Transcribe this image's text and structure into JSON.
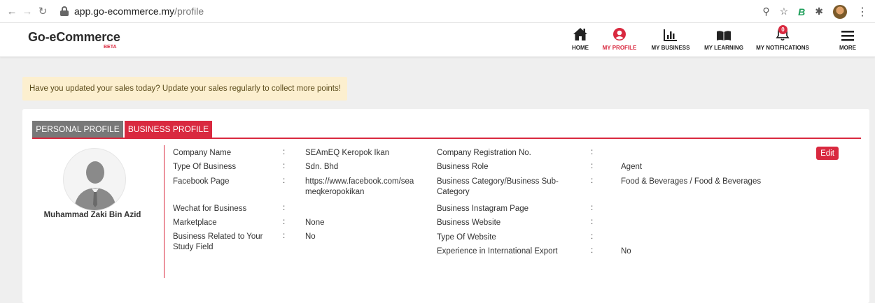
{
  "browser": {
    "url_host": "app.go-ecommerce.my",
    "url_path": "/profile"
  },
  "header": {
    "logo": "Go-eCommerce",
    "logo_badge": "BETA",
    "nav": [
      {
        "label": "HOME",
        "icon": "home-icon"
      },
      {
        "label": "MY PROFILE",
        "icon": "user-circle-icon",
        "active": true
      },
      {
        "label": "MY BUSINESS",
        "icon": "bar-chart-icon"
      },
      {
        "label": "MY LEARNING",
        "icon": "book-icon"
      },
      {
        "label": "MY NOTIFICATIONS",
        "icon": "bell-icon",
        "badge": "0"
      },
      {
        "label": "MORE",
        "icon": "hamburger-icon"
      }
    ]
  },
  "alert": {
    "text": "Have you updated your sales today? Update your sales regularly to collect more points!"
  },
  "profile": {
    "tabs": [
      "PERSONAL PROFILE",
      "BUSINESS PROFILE"
    ],
    "user_name": "Muhammad Zaki Bin Azid",
    "edit_label": "Edit",
    "left_fields": [
      {
        "label": "Company Name",
        "value": "SEAmEQ Keropok Ikan"
      },
      {
        "label": "Type Of Business",
        "value": "Sdn. Bhd"
      },
      {
        "label": "Facebook Page",
        "value": "https://www.facebook.com/seameqkeropokikan"
      },
      {
        "label": "Wechat for Business",
        "value": ""
      },
      {
        "label": "Marketplace",
        "value": "None"
      },
      {
        "label": "Business Related to Your Study Field",
        "value": "No"
      }
    ],
    "right_fields": [
      {
        "label": "Company Registration No.",
        "value": ""
      },
      {
        "label": "Business Role",
        "value": "Agent"
      },
      {
        "label": "Business Category/Business Sub-Category",
        "value": "Food & Beverages / Food & Beverages"
      },
      {
        "label": "Business Instagram Page",
        "value": ""
      },
      {
        "label": "Business Website",
        "value": ""
      },
      {
        "label": "Type Of Website",
        "value": ""
      },
      {
        "label": "Experience in International Export",
        "value": "No"
      }
    ]
  },
  "colors": {
    "accent": "#d9293f",
    "tab_inactive": "#787878",
    "alert_bg": "#fcefcf"
  }
}
